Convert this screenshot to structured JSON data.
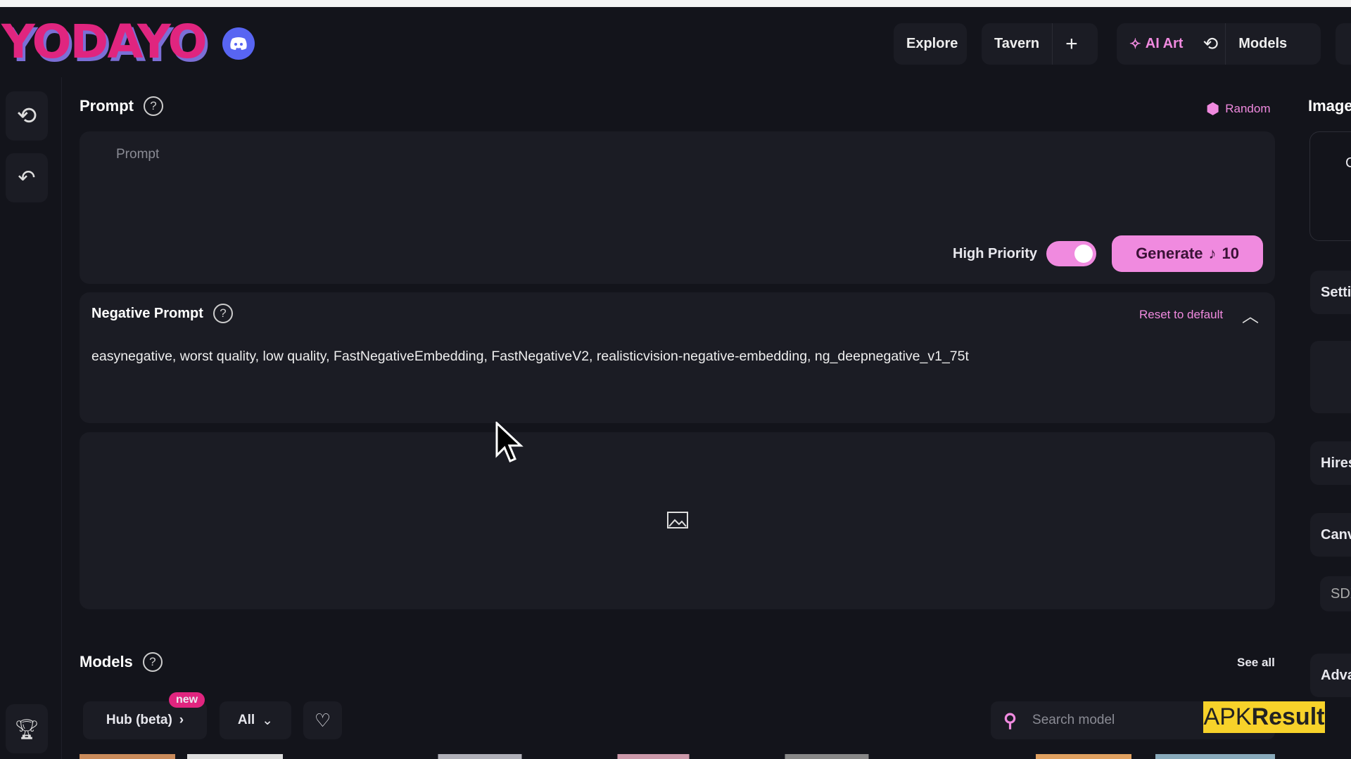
{
  "brand": {
    "logo": "YODAYO"
  },
  "nav": {
    "explore": "Explore",
    "tavern": "Tavern",
    "ai_art": "AI Art",
    "models": "Models"
  },
  "prompt": {
    "label": "Prompt",
    "help": "?",
    "random": "Random",
    "placeholder": "Prompt",
    "high_priority": "High Priority",
    "high_priority_on": true,
    "generate": "Generate",
    "generate_cost": "10"
  },
  "negative": {
    "label": "Negative Prompt",
    "help": "?",
    "reset": "Reset to default",
    "value": "easynegative, worst quality, low quality, FastNegativeEmbedding, FastNegativeV2, realisticvision-negative-embedding, ng_deepnegative_v1_75t"
  },
  "models": {
    "label": "Models",
    "help": "?",
    "see_all": "See all",
    "hub": "Hub (beta)",
    "new_badge": "new",
    "filter": "All",
    "search_placeholder": "Search model"
  },
  "right_panel": {
    "image": "Image",
    "c": "C",
    "settings": "Setti",
    "hires": "Hires",
    "canvas": "Canv",
    "sdx": "SDX",
    "advanced": "Adva"
  },
  "watermark": {
    "apk": "APK",
    "result": "Result"
  },
  "colors": {
    "accent": "#f08adf",
    "logo": "#e0257f",
    "discord": "#5865f2",
    "background": "#13141b",
    "panel": "#1b1c24"
  }
}
